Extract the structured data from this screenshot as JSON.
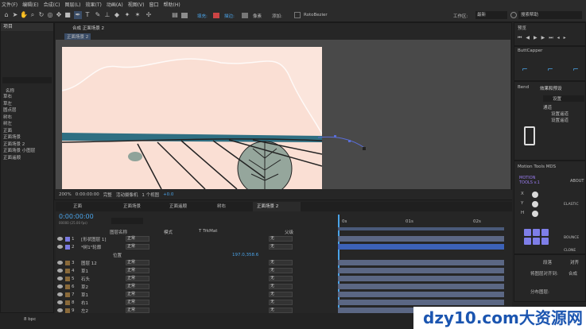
{
  "menu": [
    "文件(F)",
    "编辑(E)",
    "合成(C)",
    "图层(L)",
    "效果(T)",
    "动画(A)",
    "视图(V)",
    "窗口",
    "帮助(H)"
  ],
  "toolbar": {
    "fill_label": "填充:",
    "stroke_label": "描边:",
    "px_label": "像素",
    "add_label": "添加:",
    "rotobezier_label": "RotoBezier",
    "workspace_label": "工作区:",
    "workspace_value": "最新",
    "search_placeholder": "搜索帮助"
  },
  "project": {
    "title": "项目",
    "col_name": "名称",
    "items": [
      "草右",
      "草左",
      "圆点层",
      "树右",
      "树左",
      "正面",
      "正面场景",
      "正面场景 2",
      "正面场景 小图层",
      "正面遥顺"
    ]
  },
  "comp": {
    "tab": "合成 正面场景 2",
    "sub_tab": "正面场景 2",
    "zoom": "200%",
    "time": "0:00:00:00",
    "quality": "完整",
    "camera": "活动摄像机",
    "views": "1 个视图",
    "offset": "+0.0"
  },
  "preview": {
    "title": "预览"
  },
  "buttcapper": {
    "title": "ButtCapper"
  },
  "bend": {
    "tab1": "Bend",
    "tab2": "效果和预设",
    "search": "设置",
    "group": "通道",
    "item1": "设置遥道",
    "item2": "设置遥道"
  },
  "motion": {
    "title": "Motion Tools MDS",
    "brand": "MOTION TOOLS v.1",
    "about": "ABOUT",
    "elastic": "ELASTIC",
    "bounce": "BOUNCE",
    "clone": "CLONE",
    "rows": [
      "X",
      "Y",
      "H"
    ]
  },
  "align": {
    "tab1": "段落",
    "tab2": "对齐",
    "label1": "将图层对齐到:",
    "value1": "合成",
    "label2": "分布图层:"
  },
  "timeline": {
    "tabs": [
      "正面",
      "正面场景",
      "正面遥顺",
      "树右",
      "正面场景 2"
    ],
    "time": "0:00:00:00",
    "fps": "00000 (25.00 fps)",
    "col_name": "图层名称",
    "col_mode": "模式",
    "col_track": "T TrkMat",
    "col_parent": "父级",
    "position_label": "位置",
    "position_value": "197.0,358.6",
    "ruler": [
      "0s",
      "01s",
      "02s"
    ],
    "layers": [
      {
        "num": "1",
        "name": "[形状图层 1]",
        "mode": "正常",
        "parent": "无"
      },
      {
        "num": "2",
        "name": "*树1\"轮廓",
        "mode": "正常",
        "parent": "无"
      },
      {
        "num": "3",
        "name": "图层 12",
        "mode": "正常",
        "parent": "无"
      },
      {
        "num": "4",
        "name": "草1",
        "mode": "正常",
        "parent": "无"
      },
      {
        "num": "5",
        "name": "石头",
        "mode": "正常",
        "parent": "无"
      },
      {
        "num": "6",
        "name": "草2",
        "mode": "正常",
        "parent": "无"
      },
      {
        "num": "7",
        "name": "草1",
        "mode": "正常",
        "parent": "无"
      },
      {
        "num": "8",
        "name": "右1",
        "mode": "正常",
        "parent": "无"
      },
      {
        "num": "9",
        "name": "左2",
        "mode": "正常",
        "parent": "无"
      }
    ]
  },
  "watermark": "dzy10.com大资源网",
  "status": "8 bpc"
}
